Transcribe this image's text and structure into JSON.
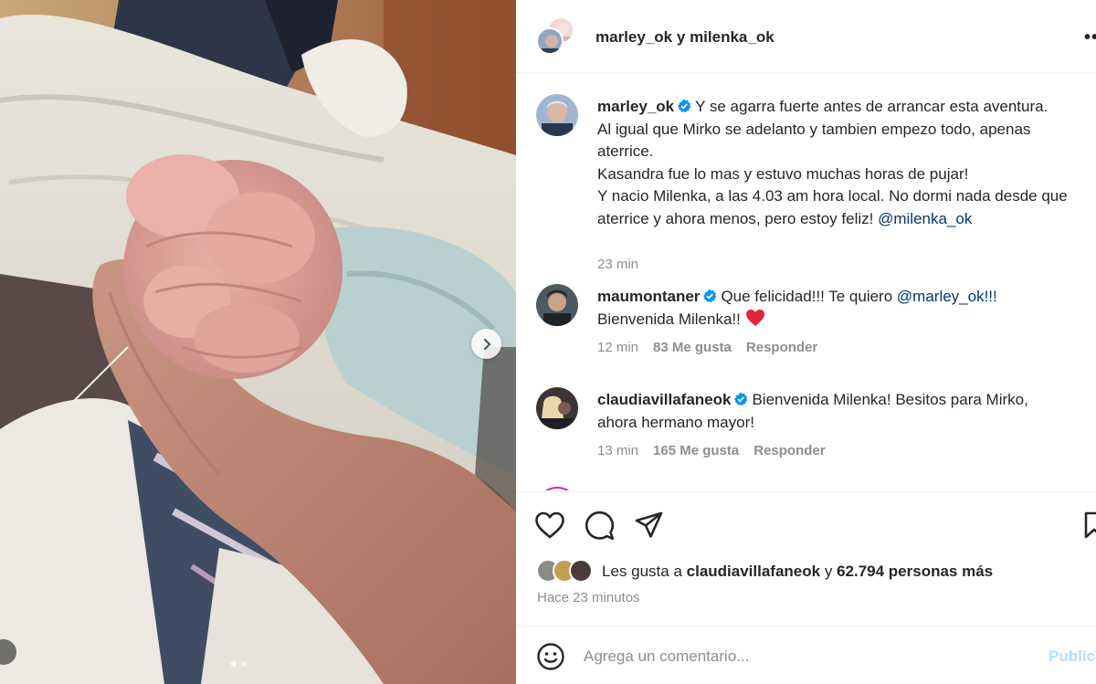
{
  "post": {
    "header": {
      "user1": "marley_ok",
      "joiner": "y",
      "user2": "milenka_ok"
    },
    "caption": {
      "username": "marley_ok",
      "line1": "Y se agarra fuerte antes de arrancar esta aventura.",
      "line2": "Al igual que Mirko se adelanto y tambien empezo todo, apenas aterrice.",
      "line3": "Kasandra fue lo mas y estuvo muchas horas de pujar!",
      "line4": "Y nacio Milenka, a las 4.03 am hora local. No dormi nada desde que aterrice y ahora menos, pero estoy feliz!",
      "mention": "@milenka_ok",
      "time": "23 min"
    },
    "comments": [
      {
        "username": "maumontaner",
        "text": "Que felicidad!!! Te quiero",
        "mention": "@marley_ok!!!",
        "text2": "Bienvenida Milenka!!",
        "time": "12 min",
        "likes": "83 Me gusta",
        "reply": "Responder"
      },
      {
        "username": "claudiavillafaneok",
        "text": "Bienvenida Milenka! Besitos para Mirko, ahora hermano mayor!",
        "time": "13 min",
        "likes": "165 Me gusta",
        "reply": "Responder"
      }
    ],
    "likes": {
      "prefix": "Les gusta a",
      "user": "claudiavillafaneok",
      "joiner": "y",
      "others": "62.794 personas más"
    },
    "time_ago": "Hace 23 minutos",
    "comment_box": {
      "placeholder": "Agrega un comentario...",
      "post_label": "Publicar"
    },
    "carousel": {
      "count": 2,
      "active_index": 0
    }
  },
  "colors": {
    "verified": "#0095f6",
    "mention": "#00376b",
    "heart": "#e0263a",
    "muted": "#8e8e8e"
  }
}
